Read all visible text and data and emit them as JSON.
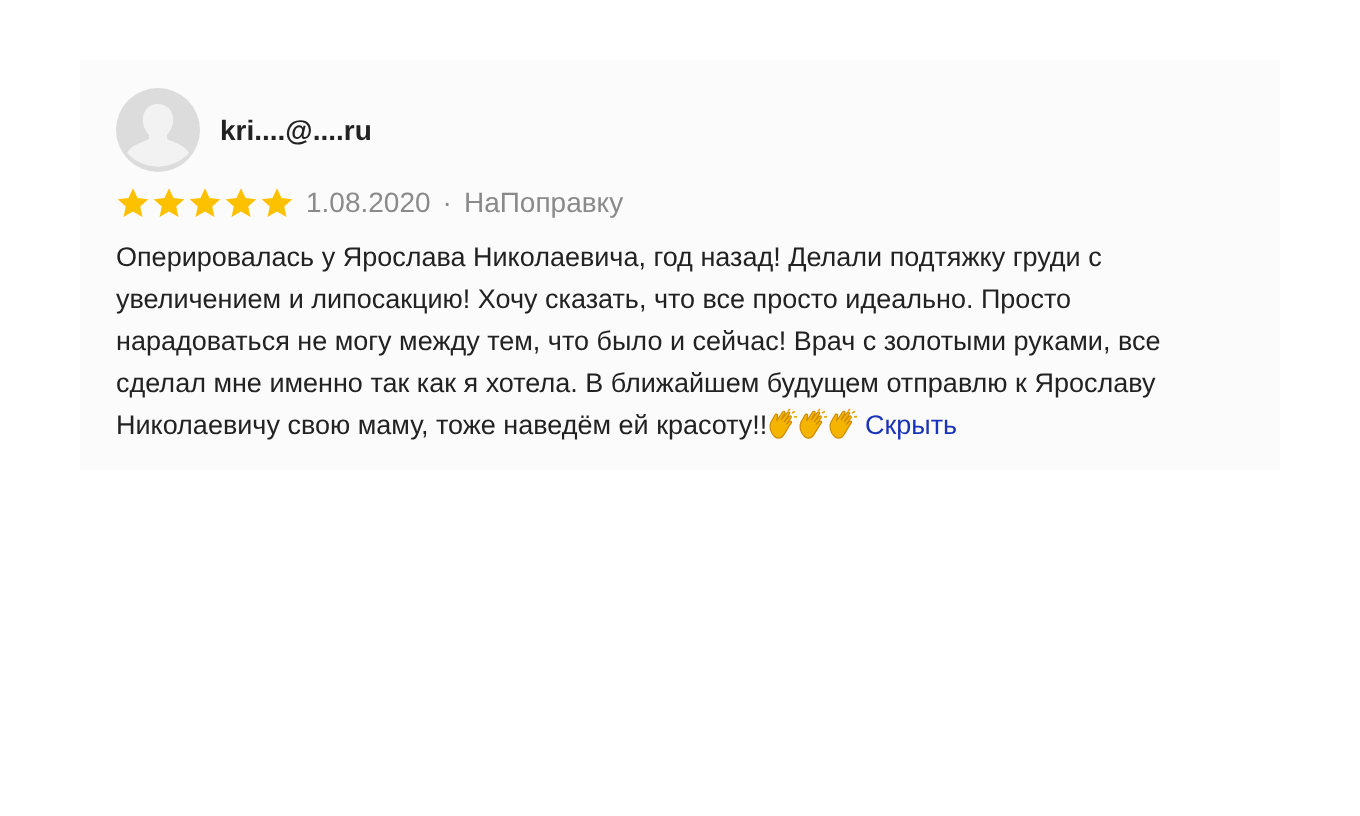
{
  "review": {
    "author": "kri....@....ru",
    "stars": 5,
    "date": "1.08.2020",
    "separator": "·",
    "source": "НаПоправку",
    "text": "Оперировалась у Ярослава Николаевича, год назад! Делали подтяжку груди с увеличением и липосакцию! Хочу сказать, что все просто идеально. Просто нарадоваться не могу между тем, что было и сейчас! Врач с золотыми руками, все сделал мне именно так как я хотела. В ближайшем будущем отправлю к Ярославу Николаевичу свою маму, тоже наведём ей красоту!!",
    "hide_link": "Скрыть"
  }
}
